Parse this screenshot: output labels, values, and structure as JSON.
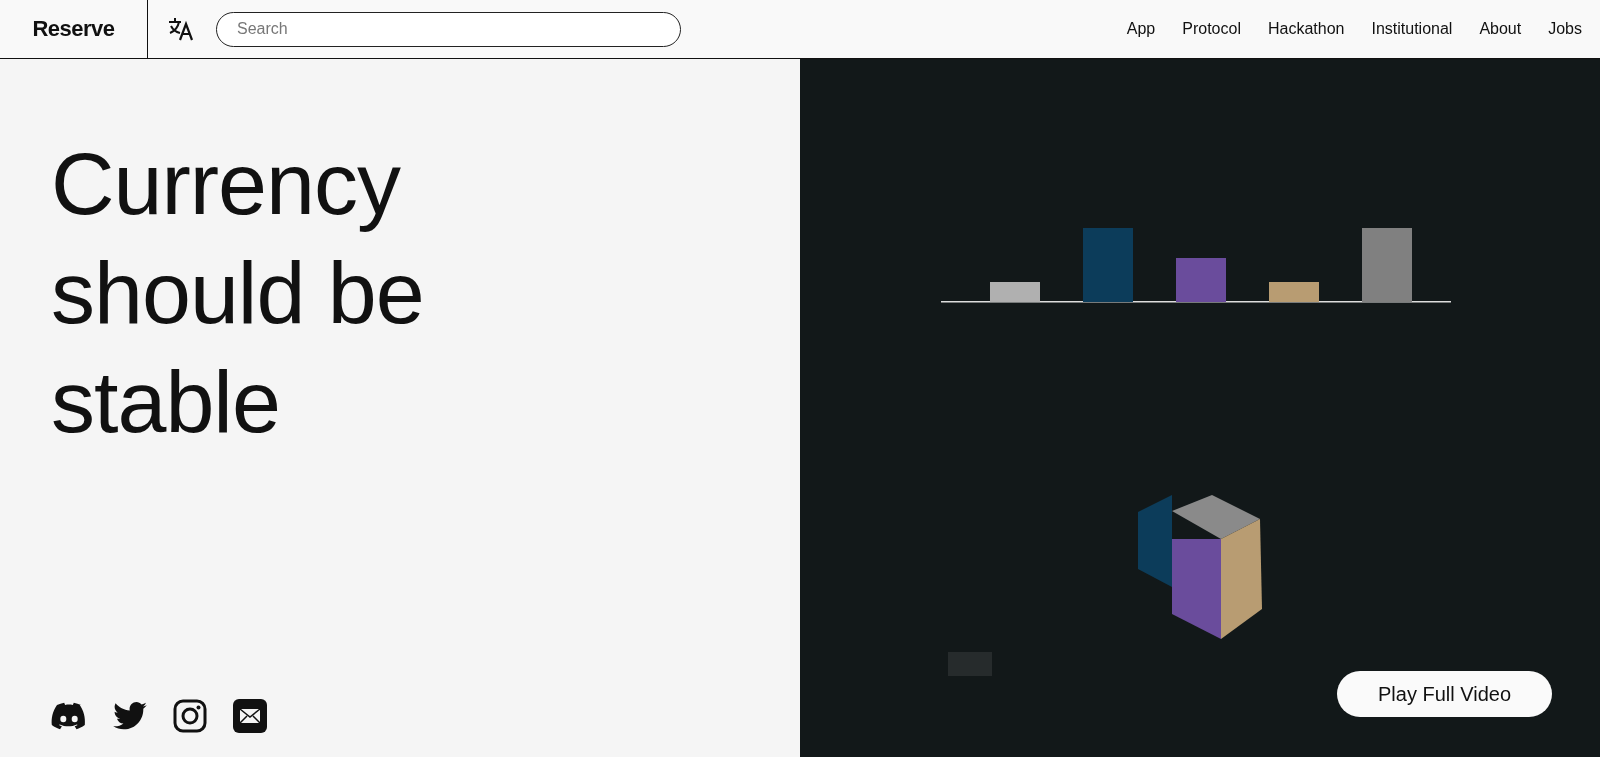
{
  "header": {
    "logo": "Reserve",
    "search": {
      "placeholder": "Search"
    },
    "nav": [
      "App",
      "Protocol",
      "Hackathon",
      "Institutional",
      "About",
      "Jobs"
    ]
  },
  "hero": {
    "headline_lines": [
      "Currency",
      "should be",
      "stable"
    ],
    "social": [
      {
        "kind": "discord"
      },
      {
        "kind": "twitter"
      },
      {
        "kind": "instagram"
      },
      {
        "kind": "email"
      }
    ]
  },
  "video": {
    "kind": "picture",
    "button": "Play Full Video"
  }
}
